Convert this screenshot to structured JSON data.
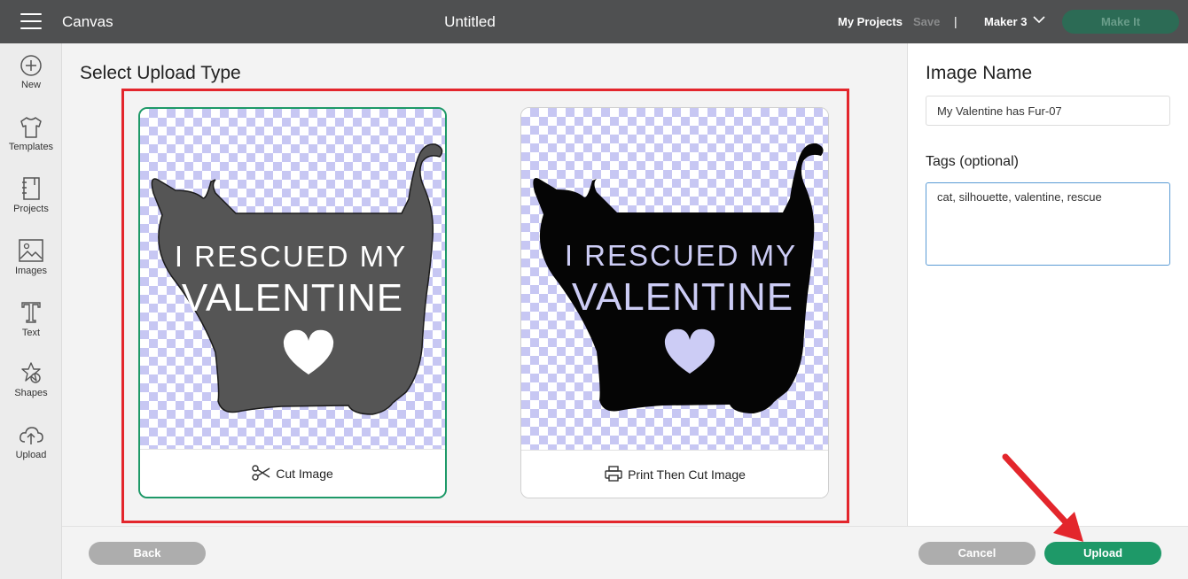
{
  "topbar": {
    "app_title": "Canvas",
    "doc_title": "Untitled",
    "my_projects": "My Projects",
    "save": "Save",
    "separator": "|",
    "machine": "Maker 3",
    "make_it": "Make It"
  },
  "sidebar": {
    "items": [
      {
        "label": "New",
        "icon": "plus-circle-icon"
      },
      {
        "label": "Templates",
        "icon": "tshirt-icon"
      },
      {
        "label": "Projects",
        "icon": "notebook-icon"
      },
      {
        "label": "Images",
        "icon": "image-icon"
      },
      {
        "label": "Text",
        "icon": "text-icon"
      },
      {
        "label": "Shapes",
        "icon": "shapes-icon"
      },
      {
        "label": "Upload",
        "icon": "cloud-upload-icon"
      }
    ]
  },
  "main": {
    "title": "Select Upload Type",
    "cards": [
      {
        "label": "Cut Image",
        "icon": "scissors-icon",
        "selected": true,
        "fill": "#555555"
      },
      {
        "label": "Print Then Cut Image",
        "icon": "printer-icon",
        "selected": false,
        "fill": "#050505"
      }
    ],
    "artwork_text": {
      "line1": "I RESCUED MY",
      "line2": "VALENTINE"
    }
  },
  "right_panel": {
    "title": "Image Name",
    "name_value": "My Valentine has Fur-07",
    "tags_label": "Tags (optional)",
    "tags_value": "cat, silhouette, valentine, rescue"
  },
  "bottom": {
    "back": "Back",
    "cancel": "Cancel",
    "upload": "Upload"
  },
  "colors": {
    "accent": "#1e9968",
    "highlight": "#e3262c",
    "topbar": "#4f5051"
  }
}
